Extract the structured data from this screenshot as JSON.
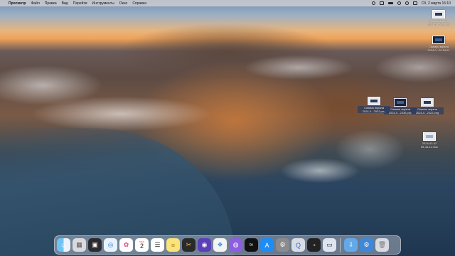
{
  "menubar": {
    "apple_icon": "apple-icon",
    "items": [
      "Просмотр",
      "Файл",
      "Правка",
      "Вид",
      "Перейти",
      "Инструменты",
      "Окно",
      "Справка"
    ],
    "clock": "Сб, 2 марта  16:10"
  },
  "desktop": {
    "files": [
      {
        "label_line1": "Снимок экрана",
        "label_line2": "2024-0...09.53.58"
      },
      {
        "label_line1": "Снимок экрана",
        "label_line2": "2024-0...09.54.51"
      },
      {
        "label_line1": "Снимок экрана",
        "label_line2": "2024-0...2032.png"
      },
      {
        "label_line1": "Снимок экрана",
        "label_line2": "2024-0...2336.png"
      },
      {
        "label_line1": "Снимок экрана",
        "label_line2": "2024-0...2022.png"
      },
      {
        "label_line1": "2024-03-02",
        "label_line2": "09-44-11.mov"
      }
    ]
  },
  "dock": {
    "calendar_month": "МАР.",
    "calendar_day": "2",
    "apps": [
      "finder-icon",
      "launchpad-icon",
      "mission-control-icon",
      "safari-icon",
      "photos-icon",
      "calendar-icon",
      "reminders-icon",
      "notes-icon",
      "final-cut-icon",
      "motion-icon",
      "preview-icon",
      "podcasts-icon",
      "apple-tv-icon",
      "app-store-icon",
      "system-settings-icon",
      "quicktime-icon",
      "activity-monitor-icon",
      "screenshot-icon",
      "downloads-icon",
      "folder-icon",
      "trash-icon"
    ]
  },
  "colors": {
    "menubar_bg": "#dcd6d2",
    "dock_bg": "#c8cdd7"
  }
}
